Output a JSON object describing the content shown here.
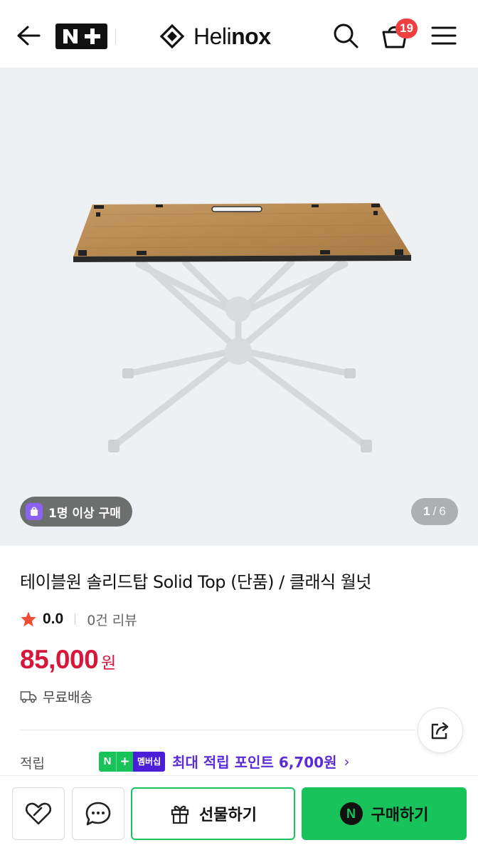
{
  "header": {
    "back_icon": "arrow-left-icon",
    "nplus_logo": "N+",
    "brand_prefix": "Heli",
    "brand_suffix": "nox",
    "cart_count": "19"
  },
  "hero": {
    "buy_badge": "1명 이상 구매",
    "pager_current": "1",
    "pager_sep": "/",
    "pager_total": "6"
  },
  "product": {
    "title": "테이블원 솔리드탑 Solid Top (단품) / 클래식 월넛",
    "rating": "0.0",
    "review_count": "0건 리뷰",
    "price": "85,000",
    "currency": "원",
    "shipping": "무료배송"
  },
  "points": {
    "label": "적립",
    "badge_text": "멤버십",
    "text": "최대 적립 포인트 6,700원"
  },
  "actions": {
    "gift_label": "선물하기",
    "buy_label": "구매하기"
  },
  "colors": {
    "accent_green": "#19c35b",
    "price_red": "#d4173b",
    "point_purple": "#5a2bd8",
    "badge_red": "#ef3f3f"
  }
}
